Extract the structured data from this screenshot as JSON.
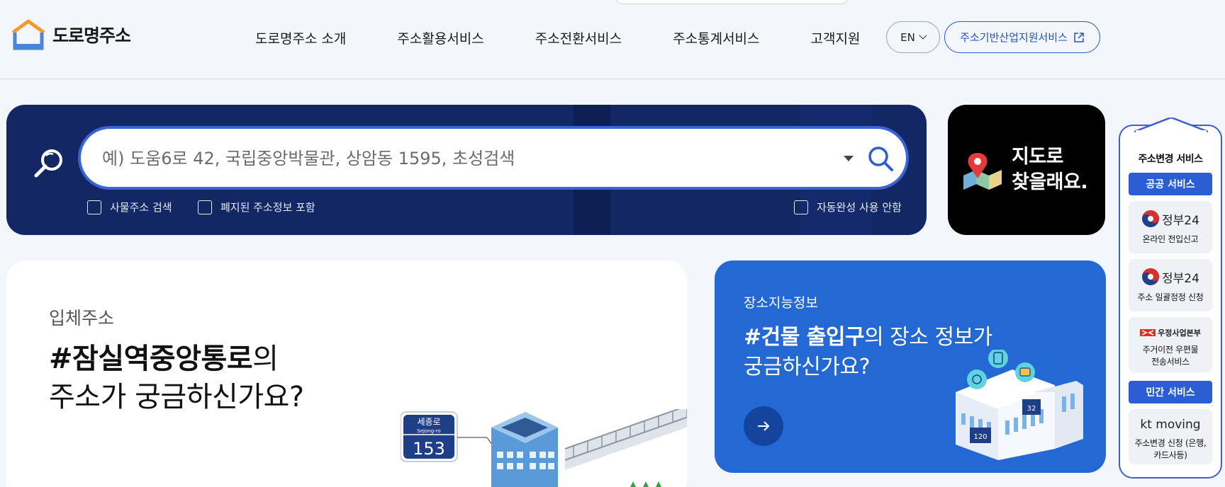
{
  "header": {
    "logo_text": "도로명주소",
    "nav": [
      "도로명주소 소개",
      "주소활용서비스",
      "주소전환서비스",
      "주소통계서비스",
      "고객지원"
    ],
    "lang": "EN",
    "support_link": "주소기반산업지원서비스"
  },
  "search": {
    "placeholder": "예) 도움6로 42, 국립중앙박물관, 상암동 1595, 초성검색",
    "options": {
      "thing_address": "사물주소 검색",
      "include_abolished": "폐지된 주소정보 포함",
      "no_autocomplete": "자동완성 사용 안함"
    }
  },
  "map_card": {
    "line1": "지도로",
    "line2": "찾을래요."
  },
  "card_3d": {
    "subtitle": "입체주소",
    "highlight": "#잠실역중앙통로",
    "suffix": "의",
    "line2": "주소가 궁금하신가요?",
    "sign_road": "세종로",
    "sign_roman": "Sejong-ro",
    "sign_number": "153"
  },
  "card_info": {
    "subtitle": "장소지능정보",
    "highlight": "#건물 출입구",
    "suffix": "의 장소 정보가",
    "line2": "궁금하신가요?",
    "sign_a": "120",
    "sign_b": "32"
  },
  "sidebar": {
    "title": "주소변경 서비스",
    "public_tag": "공공 서비스",
    "private_tag": "민간 서비스",
    "items": [
      {
        "brand": "정부24",
        "desc": "온라인 전입신고"
      },
      {
        "brand": "정부24",
        "desc": "주소 일괄정정 신청"
      },
      {
        "brand": "우정사업본부",
        "desc": "주거이전 우편물 전송서비스"
      },
      {
        "brand": "kt moving",
        "desc": "주소변경 신청 (은행,카드사등)"
      }
    ]
  },
  "colors": {
    "accent": "#2b5ed3",
    "search_panel": "#122764",
    "info_card": "#2468d4"
  }
}
